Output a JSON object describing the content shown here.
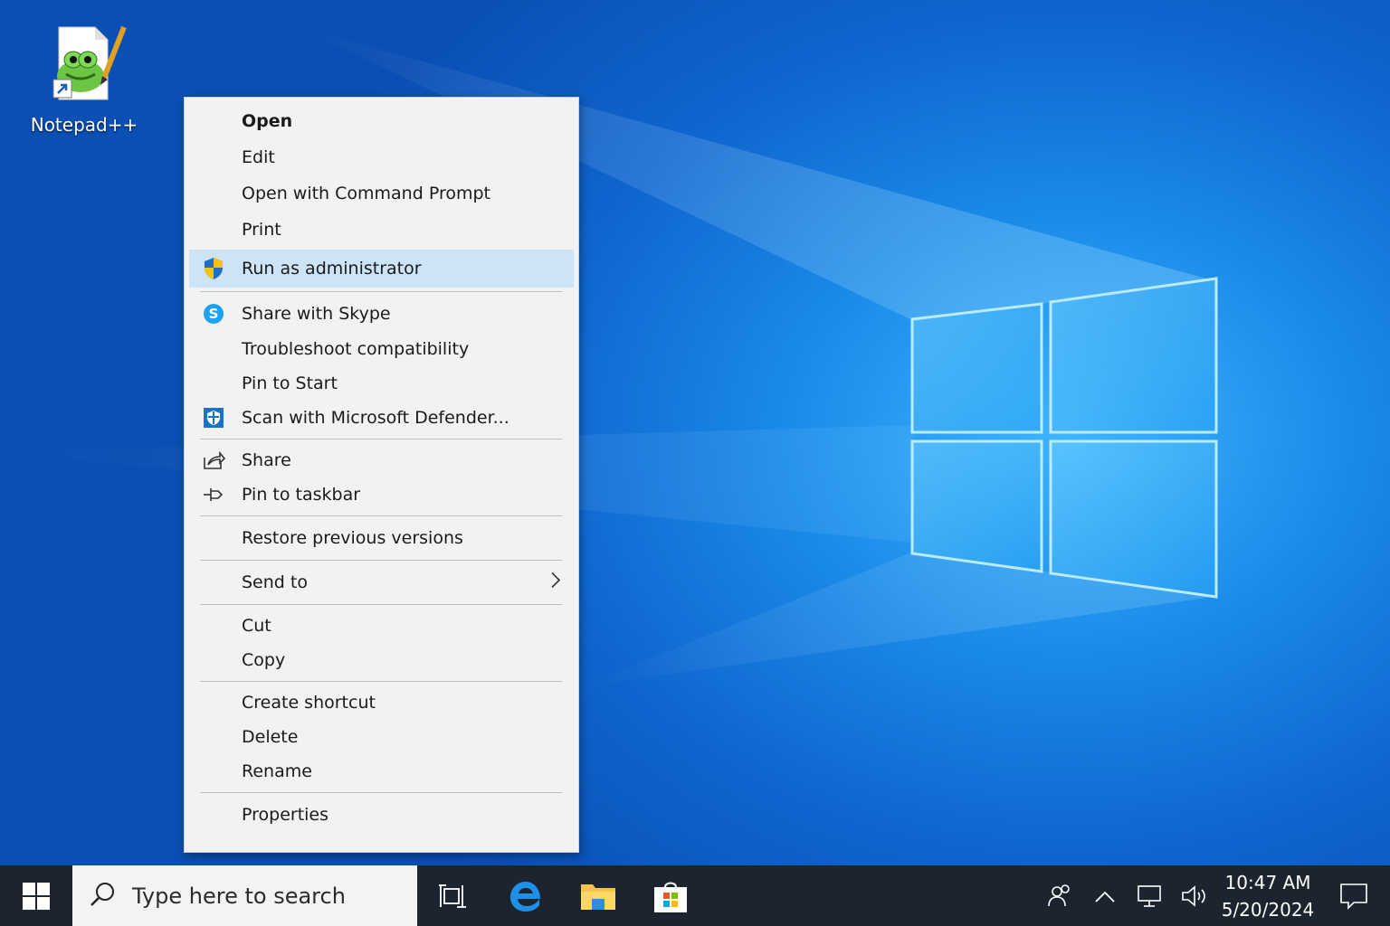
{
  "desktop": {
    "icon_label": "Notepad++"
  },
  "context_menu": {
    "items": [
      {
        "label": "Open"
      },
      {
        "label": "Edit"
      },
      {
        "label": "Open with Command Prompt"
      },
      {
        "label": "Print"
      },
      {
        "label": "Run as administrator",
        "icon": "shield-icon",
        "highlighted": true
      },
      {
        "label": "Share with Skype",
        "icon": "skype-icon"
      },
      {
        "label": "Troubleshoot compatibility"
      },
      {
        "label": "Pin to Start"
      },
      {
        "label": "Scan with Microsoft Defender...",
        "icon": "defender-icon"
      },
      {
        "label": "Share",
        "icon": "share-icon"
      },
      {
        "label": "Pin to taskbar",
        "icon": "pin-icon"
      },
      {
        "label": "Restore previous versions"
      },
      {
        "label": "Send to",
        "icon": "chevron-right-icon"
      },
      {
        "label": "Cut"
      },
      {
        "label": "Copy"
      },
      {
        "label": "Create shortcut"
      },
      {
        "label": "Delete"
      },
      {
        "label": "Rename"
      },
      {
        "label": "Properties"
      }
    ]
  },
  "taskbar": {
    "search_placeholder": "Type here to search",
    "time": "10:47 AM",
    "date": "5/20/2024",
    "apps": [
      "task-view-icon",
      "edge-icon",
      "file-explorer-icon",
      "store-icon"
    ],
    "tray": [
      "people-icon",
      "chevron-up-icon",
      "network-icon",
      "volume-icon",
      "notification-icon"
    ]
  },
  "colors": {
    "highlight": "#cde4f7",
    "taskbar": "#1c2430",
    "desktop_blue": "#1a8ae8"
  }
}
